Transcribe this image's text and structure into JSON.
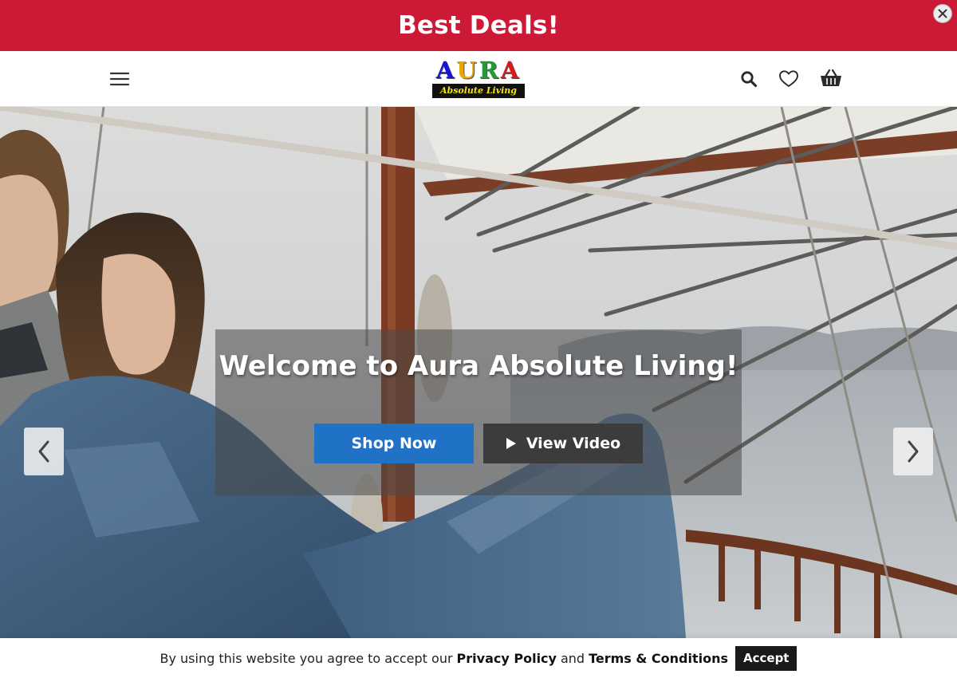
{
  "promo": {
    "text": "Best Deals!",
    "background": "#cc1a36"
  },
  "header": {
    "logo": {
      "letters": [
        {
          "char": "A",
          "color": "#1515d8"
        },
        {
          "char": "U",
          "color": "#e8a800"
        },
        {
          "char": "R",
          "color": "#1e9e2e"
        },
        {
          "char": "A",
          "color": "#d81a1a"
        }
      ],
      "tagline": "Absolute Living"
    },
    "icons": [
      "menu-icon",
      "search-icon",
      "heart-icon",
      "basket-icon"
    ]
  },
  "hero": {
    "title": "Welcome to Aura Absolute Living!",
    "shop_label": "Shop Now",
    "video_label": "View Video",
    "shop_color": "#1f72c6"
  },
  "cookie": {
    "prefix": "By using this website you agree to accept our",
    "privacy": "Privacy Policy",
    "and": "and",
    "terms": "Terms & Conditions",
    "accept": "Accept"
  }
}
